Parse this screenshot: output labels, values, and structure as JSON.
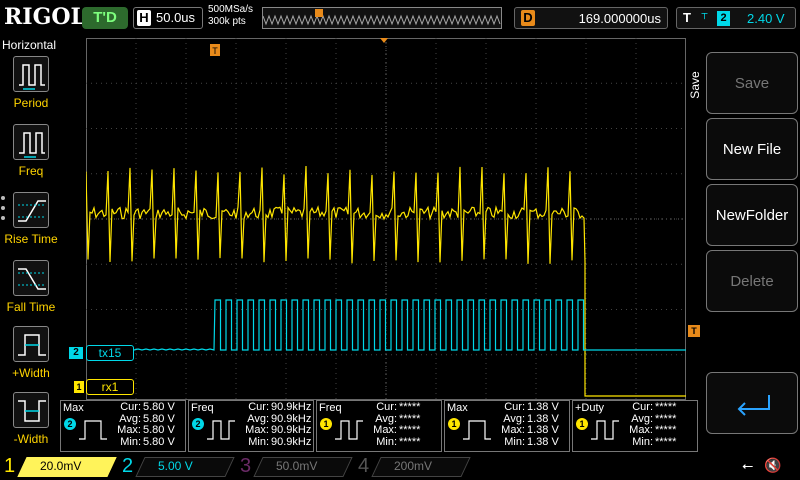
{
  "brand": "RIGOL",
  "top": {
    "run_state": "T'D",
    "horizontal_label": "H",
    "timebase": "50.0us",
    "sample_rate": "500MSa/s",
    "memory_depth": "300k pts",
    "delay_label": "D",
    "delay_value": "169.000000us",
    "trigger_label": "T",
    "trigger_edge": "rising",
    "trigger_source": "2",
    "trigger_level": "2.40 V"
  },
  "left_panel": {
    "title": "Horizontal",
    "items": [
      {
        "label": "Period",
        "icon": "period-icon"
      },
      {
        "label": "Freq",
        "icon": "frequency-icon"
      },
      {
        "label": "Rise Time",
        "icon": "rise-time-icon"
      },
      {
        "label": "Fall Time",
        "icon": "fall-time-icon"
      },
      {
        "label": "+Width",
        "icon": "positive-width-icon"
      },
      {
        "label": "-Width",
        "icon": "negative-width-icon"
      }
    ]
  },
  "channels_on_screen": {
    "ch2_label": "tx15",
    "ch1_label": "rx1",
    "ch2_marker": "2",
    "ch1_marker": "1"
  },
  "right_menu": {
    "title": "Save",
    "buttons": [
      {
        "label": "Save",
        "enabled": false
      },
      {
        "label": "New File",
        "enabled": true
      },
      {
        "label": "NewFolder",
        "enabled": true
      },
      {
        "label": "Delete",
        "enabled": false
      }
    ],
    "return_icon": "return-arrow-icon"
  },
  "measurements": [
    {
      "name": "Max",
      "source": "2",
      "color": "#00d8e8",
      "rows": [
        [
          "Cur:",
          "5.80 V"
        ],
        [
          "Avg:",
          "5.80 V"
        ],
        [
          "Max:",
          "5.80 V"
        ],
        [
          "Min:",
          "5.80 V"
        ]
      ]
    },
    {
      "name": "Freq",
      "source": "2",
      "color": "#00d8e8",
      "rows": [
        [
          "Cur:",
          "90.9kHz"
        ],
        [
          "Avg:",
          "90.9kHz"
        ],
        [
          "Max:",
          "90.9kHz"
        ],
        [
          "Min:",
          "90.9kHz"
        ]
      ]
    },
    {
      "name": "Freq",
      "source": "1",
      "color": "#ffe600",
      "rows": [
        [
          "Cur:",
          "*****"
        ],
        [
          "Avg:",
          "*****"
        ],
        [
          "Max:",
          "*****"
        ],
        [
          "Min:",
          "*****"
        ]
      ]
    },
    {
      "name": "Max",
      "source": "1",
      "color": "#ffe600",
      "rows": [
        [
          "Cur:",
          "1.38 V"
        ],
        [
          "Avg:",
          "1.38 V"
        ],
        [
          "Max:",
          "1.38 V"
        ],
        [
          "Min:",
          "1.38 V"
        ]
      ]
    },
    {
      "name": "+Duty",
      "source": "1",
      "color": "#ffe600",
      "rows": [
        [
          "Cur:",
          "*****"
        ],
        [
          "Avg:",
          "*****"
        ],
        [
          "Max:",
          "*****"
        ],
        [
          "Min:",
          "*****"
        ]
      ]
    }
  ],
  "channel_bar": [
    {
      "num": "1",
      "scale": "20.0mV",
      "color": "#ffe600",
      "active": true
    },
    {
      "num": "2",
      "scale": "5.00 V",
      "color": "#00d8e8",
      "active": false
    },
    {
      "num": "3",
      "scale": "50.0mV",
      "color": "#d040c8",
      "active": false
    },
    {
      "num": "4",
      "scale": "200mV",
      "color": "#3a7cff",
      "active": false
    }
  ],
  "colors": {
    "ch1": "#ffe600",
    "ch2": "#00d8e8",
    "trigger": "#e88a1a",
    "grid": "#555555"
  }
}
